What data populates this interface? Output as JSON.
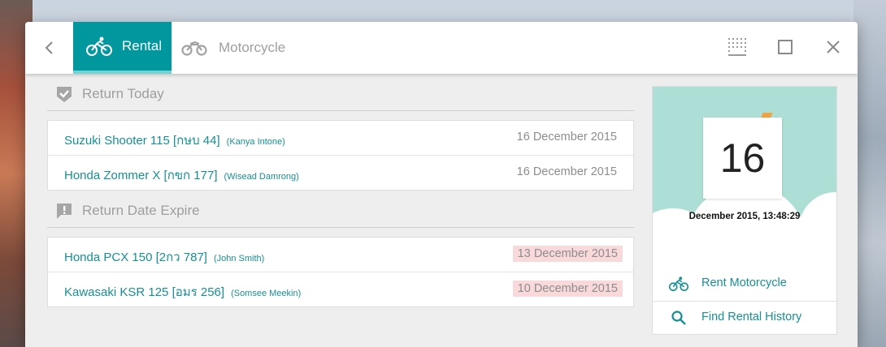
{
  "header": {
    "tabs": [
      {
        "label": "Rental",
        "icon": "bicycle-icon",
        "active": true
      },
      {
        "label": "Motorcycle",
        "icon": "motorcycle-icon",
        "active": false
      }
    ]
  },
  "sections": {
    "return_today": {
      "title": "Return Today",
      "icon": "shield-check-icon",
      "rows": [
        {
          "bike": "Suzuki Shooter 115 [กษบ 44]",
          "person": "(Kanya Intone)",
          "date": "16 December 2015"
        },
        {
          "bike": "Honda Zommer X [กขก 177]",
          "person": "(Wisead Damrong)",
          "date": "16 December 2015"
        }
      ]
    },
    "return_expire": {
      "title": "Return Date Expire",
      "icon": "alert-comment-icon",
      "rows": [
        {
          "bike": "Honda PCX 150 [2กว 787]",
          "person": "(John Smith)",
          "date": "13 December 2015"
        },
        {
          "bike": "Kawasaki KSR 125 [อมร 256]",
          "person": "(Somsee Meekin)",
          "date": "10 December 2015"
        }
      ]
    }
  },
  "calendar": {
    "day": "16",
    "datetime": "December 2015, 13:48:29"
  },
  "actions": {
    "rent_label": "Rent Motorcycle",
    "find_label": "Find Rental History"
  },
  "colors": {
    "accent": "#00989e",
    "link": "#168f96",
    "expired_bg": "#f9d9d9",
    "calendar_bg": "#aedfd6"
  }
}
